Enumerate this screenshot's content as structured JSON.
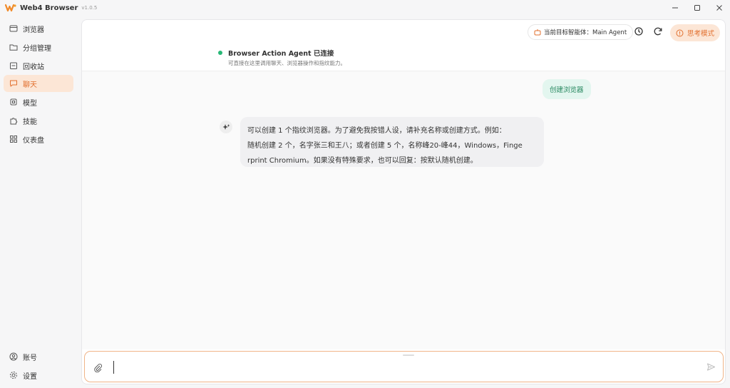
{
  "app": {
    "title": "Web4 Browser",
    "version": "v1.0.5"
  },
  "sidebar": {
    "items": [
      {
        "label": "浏览器",
        "icon": "browser-window-icon"
      },
      {
        "label": "分组管理",
        "icon": "folder-group-icon"
      },
      {
        "label": "回收站",
        "icon": "recycle-bin-icon"
      },
      {
        "label": "聊天",
        "icon": "chat-bubble-icon",
        "active": true
      },
      {
        "label": "模型",
        "icon": "model-cube-icon"
      },
      {
        "label": "技能",
        "icon": "skill-puzzle-icon"
      },
      {
        "label": "仪表盘",
        "icon": "dashboard-grid-icon"
      }
    ],
    "bottom": [
      {
        "label": "账号",
        "icon": "user-circle-icon"
      },
      {
        "label": "设置",
        "icon": "gear-icon"
      }
    ]
  },
  "header": {
    "agent_label": "当前目标智能体：Main Agent",
    "think_mode": "思考模式"
  },
  "status": {
    "title": "Browser Action Agent 已连接",
    "subtitle": "可直接在这里调用聊天、浏览器操作和指纹能力。"
  },
  "messages": {
    "user": "创建浏览器",
    "bot_lines": [
      "可以创建 1 个指纹浏览器。为了避免我按错人设，请补充名称或创建方式。例如：",
      "随机创建 2 个，名字张三和王八；或者创建 5 个，名称峰20-峰44，Windows，Finge",
      "rprint Chromium。如果没有特殊要求，也可以回复：按默认随机创建。"
    ]
  },
  "input": {
    "value": "",
    "placeholder": ""
  },
  "colors": {
    "accent": "#e2702f",
    "accent_bg": "#fce6d6",
    "status_green": "#28b877",
    "user_bubble": "#e3f6ef"
  }
}
